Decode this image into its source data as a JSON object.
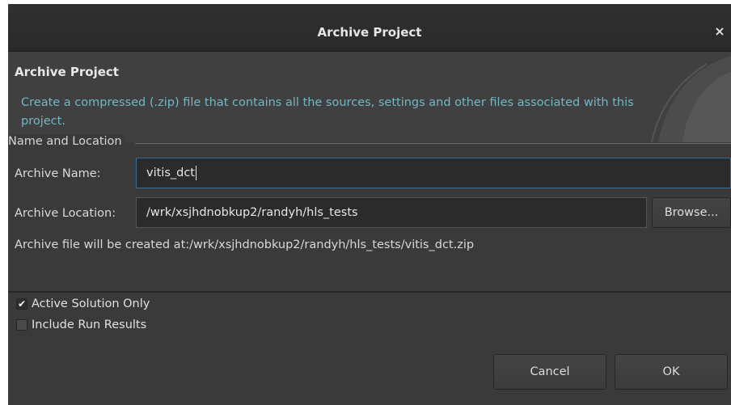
{
  "window": {
    "title": "Archive Project",
    "close_glyph": "×"
  },
  "header": {
    "title": "Archive Project",
    "description": "Create a compressed (.zip) file that contains all the sources, settings and other files associated with this project."
  },
  "name_location": {
    "group_label": "Name and Location",
    "archive_name_label": "Archive Name:",
    "archive_name_value": "vitis_dct",
    "archive_location_label": "Archive Location:",
    "archive_location_value": "/wrk/xsjhdnobkup2/randyh/hls_tests",
    "browse_label": "Browse...",
    "info_text": "Archive file will be created at:/wrk/xsjhdnobkup2/randyh/hls_tests/vitis_dct.zip"
  },
  "options": {
    "active_solution_label": "Active Solution Only",
    "active_solution_checked": true,
    "include_run_results_label": "Include Run Results",
    "include_run_results_checked": false,
    "check_glyph": "✔"
  },
  "buttons": {
    "cancel_label": "Cancel",
    "ok_label": "OK"
  },
  "icons": {
    "close": "close-icon",
    "check": "check-icon"
  },
  "colors": {
    "window_bg": "#3a3a3a",
    "header_bg": "#404040",
    "description_text": "#72b7c4",
    "focus_border": "#3d6e93"
  }
}
